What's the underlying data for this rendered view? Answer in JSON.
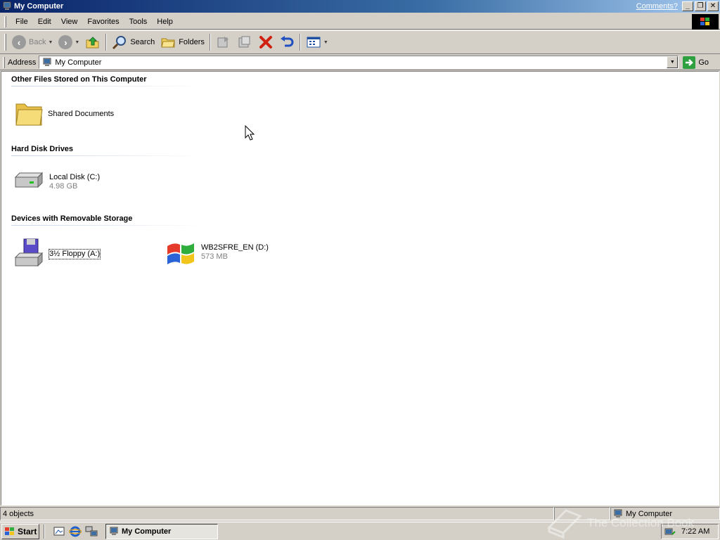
{
  "window": {
    "title": "My Computer",
    "comments_link": "Comments?",
    "controls": {
      "minimize": "_",
      "maximize": "❐",
      "close": "✕"
    }
  },
  "menu": {
    "items": [
      "File",
      "Edit",
      "View",
      "Favorites",
      "Tools",
      "Help"
    ]
  },
  "toolbar": {
    "back_label": "Back",
    "search_label": "Search",
    "folders_label": "Folders"
  },
  "address": {
    "label": "Address",
    "value": "My Computer",
    "go_label": "Go"
  },
  "groups": [
    {
      "title": "Other Files Stored on This Computer",
      "items": [
        {
          "name": "Shared Documents",
          "detail": ""
        }
      ]
    },
    {
      "title": "Hard Disk Drives",
      "items": [
        {
          "name": "Local Disk (C:)",
          "detail": "4.98 GB"
        }
      ]
    },
    {
      "title": "Devices with Removable Storage",
      "items": [
        {
          "name": "3½ Floppy (A:)",
          "detail": ""
        },
        {
          "name": "WB2SFRE_EN (D:)",
          "detail": "573 MB"
        }
      ]
    }
  ],
  "status": {
    "objects": "4 objects",
    "location": "My Computer"
  },
  "taskbar": {
    "start_label": "Start",
    "task_label": "My Computer",
    "clock": "7:22 AM"
  },
  "watermark": "The Collection Book",
  "colors": {
    "title_start": "#0a246a",
    "title_end": "#a6caf0",
    "chrome": "#d4d0c8"
  }
}
